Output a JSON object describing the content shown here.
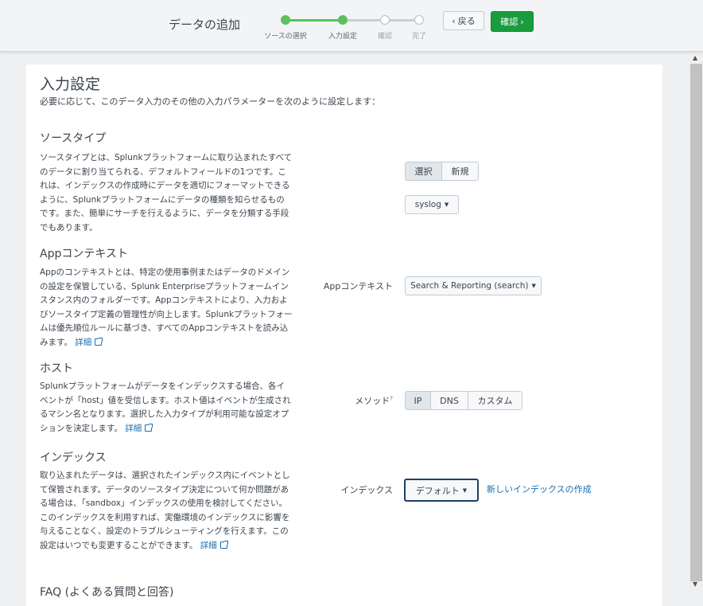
{
  "header": {
    "title": "データの追加",
    "steps": [
      {
        "label": "ソースの選択",
        "state": "done"
      },
      {
        "label": "入力設定",
        "state": "current"
      },
      {
        "label": "確認",
        "state": "todo"
      },
      {
        "label": "完了",
        "state": "todo"
      }
    ],
    "back_label": "戻る",
    "next_label": "確認"
  },
  "page": {
    "title": "入力設定",
    "description": "必要に応じて、このデータ入力のその他の入力パラメーターを次のように設定します："
  },
  "sourcetype": {
    "title": "ソースタイプ",
    "description": "ソースタイプとは、Splunkプラットフォームに取り込まれたすべてのデータに割り当てられる、デフォルトフィールドの1つです。これは、インデックスの作成時にデータを適切にフォーマットできるように、Splunkプラットフォームにデータの種類を知らせるものです。また、簡単にサーチを行えるように、データを分類する手段でもあります。",
    "toggle": [
      "選択",
      "新規"
    ],
    "toggle_selected": "選択",
    "dropdown_value": "syslog"
  },
  "app_context": {
    "title": "Appコンテキスト",
    "description": "Appのコンテキストとは、特定の使用事例またはデータのドメインの設定を保管している、Splunk Enterpriseプラットフォームインスタンス内のフォルダーです。Appコンテキストにより、入力およびソースタイプ定義の管理性が向上します。Splunkプラットフォームは優先順位ルールに基づき、すべてのAppコンテキストを読み込みます。",
    "link": "詳細",
    "field_label": "Appコンテキスト",
    "dropdown_value": "Search & Reporting (search)"
  },
  "host": {
    "title": "ホスト",
    "description": "Splunkプラットフォームがデータをインデックスする場合、各イベントが「host」値を受信します。ホスト値はイベントが生成されるマシン名となります。選択した入力タイプが利用可能な設定オプションを決定します。",
    "link": "詳細",
    "field_label": "メソッド",
    "help_mark": "?",
    "options": [
      "IP",
      "DNS",
      "カスタム"
    ],
    "selected": "IP"
  },
  "index": {
    "title": "インデックス",
    "description": "取り込まれたデータは、選択されたインデックス内にイベントとして保管されます。データのソースタイプ決定について何か問題がある場合は、「sandbox」インデックスの使用を検討してください。このインデックスを利用すれば、実働環境のインデックスに影響を与えることなく、設定のトラブルシューティングを行えます。この設定はいつでも変更することができます。",
    "link": "詳細",
    "field_label": "インデックス",
    "dropdown_value": "デフォルト",
    "create_link": "新しいインデックスの作成"
  },
  "faq": {
    "title": "FAQ (よくある質問と回答)"
  },
  "colors": {
    "accent_green": "#1a9c3e",
    "step_done": "#5cc05c",
    "link": "#1a6dae"
  }
}
